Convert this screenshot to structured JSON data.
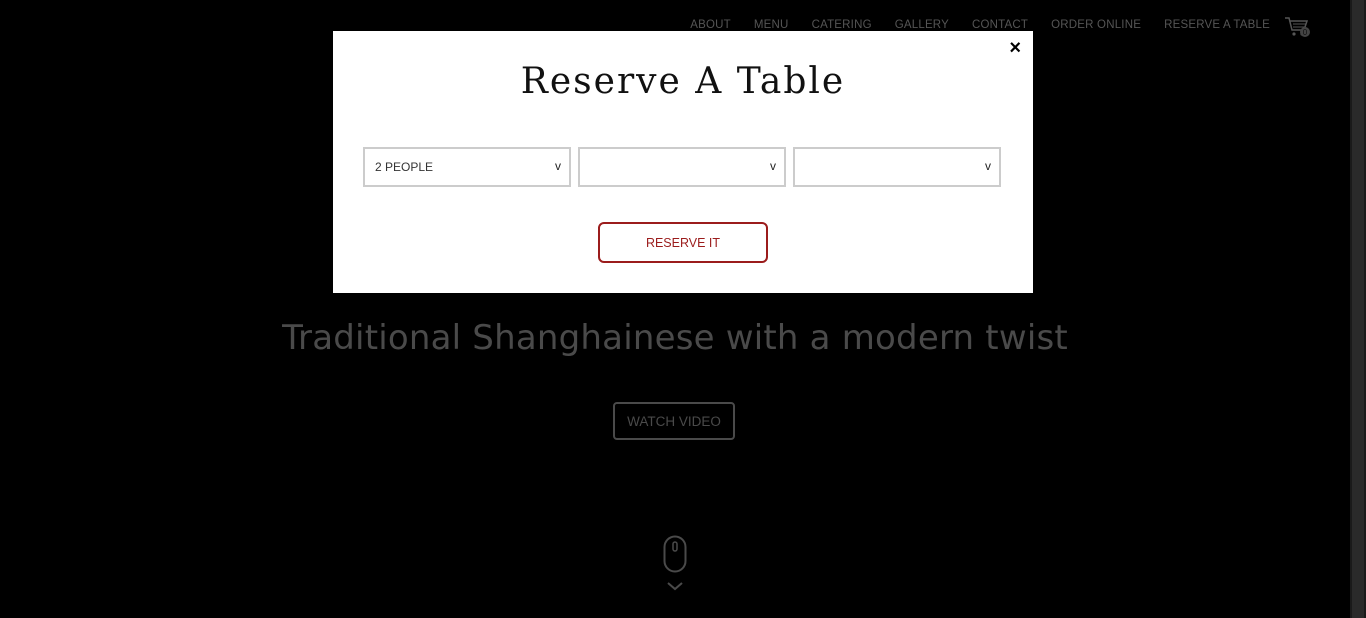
{
  "nav": {
    "items": [
      "ABOUT",
      "MENU",
      "CATERING",
      "GALLERY",
      "CONTACT",
      "ORDER ONLINE",
      "RESERVE A TABLE"
    ],
    "cart_icon": "cart-icon",
    "cart_count": "0"
  },
  "hero": {
    "tagline": "Traditional Shanghainese with a modern twist",
    "watch_video_label": "WATCH VIDEO",
    "scroll_icon": "mouse-scroll-icon"
  },
  "modal": {
    "title": "Reserve A Table",
    "close_label": "×",
    "selects": [
      {
        "value": "2 PEOPLE",
        "chevron": "v"
      },
      {
        "value": "",
        "chevron": "v"
      },
      {
        "value": "",
        "chevron": "v"
      }
    ],
    "reserve_label": "RESERVE IT"
  },
  "colors": {
    "accent": "#9b1c1c",
    "overlay_text": "#4a4a4a",
    "background": "#000000"
  }
}
